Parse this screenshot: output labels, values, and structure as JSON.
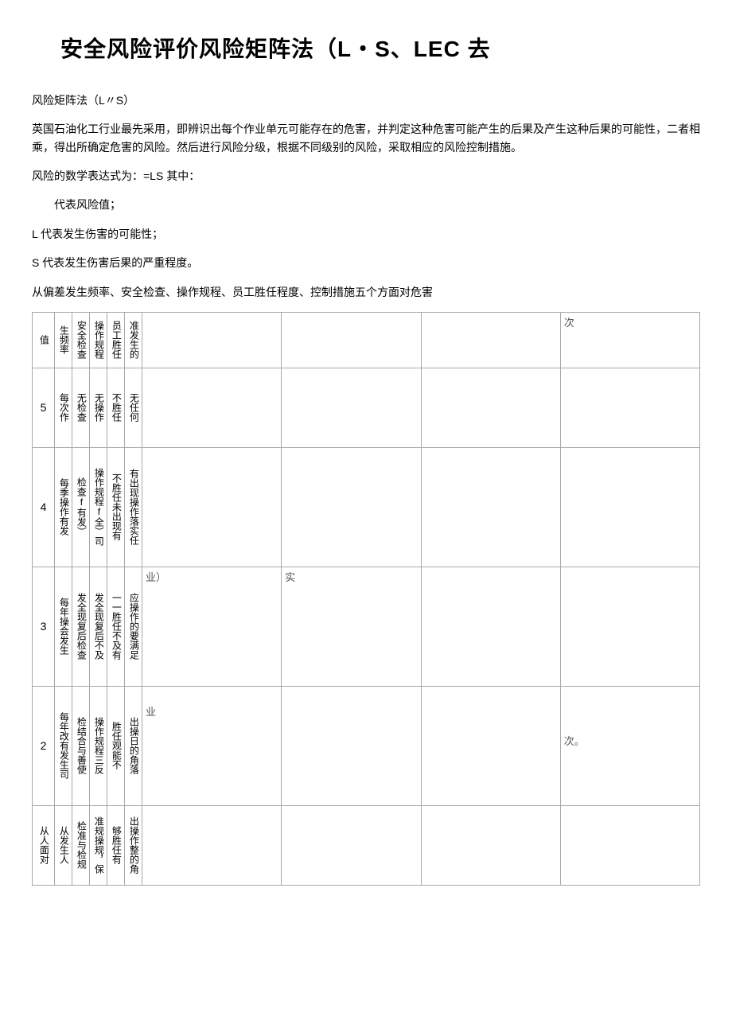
{
  "title_left": "安全风险评价风险矩阵法（",
  "title_latin": "L・S、LEC",
  "title_right": " 去",
  "paragraphs": {
    "p1": "风险矩阵法（L〃S）",
    "p2": "英国石油化工行业最先采用，即辨识出每个作业单元可能存在的危害，并判定这种危害可能产生的后果及产生这种后果的可能性，二者相乘，得出所确定危害的风险。然后进行风险分级，根据不同级别的风险，采取相应的风险控制措施。",
    "p3": "风险的数学表达式为：=LS 其中：",
    "p4": "代表风险值；",
    "p5": "L 代表发生伤害的可能性；",
    "p6": "S 代表发生伤害后果的严重程度。",
    "p7": "从偏差发生频率、安全检查、操作规程、员工胜任程度、控制措施五个方面对危害"
  },
  "table": {
    "header": {
      "c0": "值",
      "c1": "生频率",
      "c2": "安全检查",
      "c3": "操作规程",
      "c4": "员工胜任",
      "c5": "准发生的",
      "wide1": "",
      "wide2": "",
      "wide3": "",
      "wide4": "次"
    },
    "rows": [
      {
        "c0": "5",
        "c1": "每次作",
        "c2": "无检查",
        "c3": "无操作",
        "c4": "不胜任",
        "c5": "无任何",
        "wide1": "",
        "wide2": "",
        "wide3": "",
        "wide4": ""
      },
      {
        "c0": "4",
        "c1": "每季操作有发",
        "c2": "检查f有发）",
        "c3": "操作规程f全）司",
        "c4": "不胜任未出现有",
        "c5": "有出现操作落实任",
        "wide1": "",
        "wide2": "",
        "wide3": "",
        "wide4": ""
      },
      {
        "c0": "3",
        "c1": "每年操会发生",
        "c2": "发全现复后检查",
        "c3": "发全现复后不及",
        "c4": "一一胜任不及有",
        "c5": "应操作的要满足",
        "wide1": "业）",
        "wide2": "实",
        "wide3": "",
        "wide4": ""
      },
      {
        "c0": "2",
        "c1": "每年改有发生司",
        "c2": "检结合与善使",
        "c3": "操作规程三反",
        "c4": "胜任观能不",
        "c5": "出操日的角落",
        "wide1": "业",
        "wide2": "",
        "wide3": "",
        "wide4": "次。"
      },
      {
        "c0": "从人面对",
        "c1": "从发生人",
        "c2": "检准与检规",
        "c3": "准规操规，保",
        "c4": "够胜任有",
        "c5": "出操作整的角",
        "wide1": "",
        "wide2": "",
        "wide3": "",
        "wide4": ""
      }
    ]
  }
}
